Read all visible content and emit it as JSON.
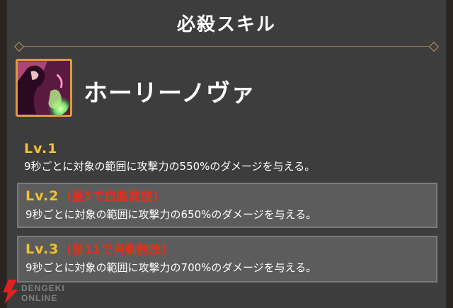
{
  "panel": {
    "title": "必殺スキル"
  },
  "skill": {
    "name": "ホーリーノヴァ",
    "icon": "holy-nova-skill-art"
  },
  "levels": [
    {
      "label": "Lv.1",
      "unlock": "",
      "description": "9秒ごとに対象の範囲に攻撃力の550%のダメージを与える。"
    },
    {
      "label": "Lv.2",
      "unlock": "(星5で自動開放)",
      "description": "9秒ごとに対象の範囲に攻撃力の650%のダメージを与える。"
    },
    {
      "label": "Lv.3",
      "unlock": "(星11で自動開放)",
      "description": "9秒ごとに対象の範囲に攻撃力の700%のダメージを与える。"
    }
  ],
  "watermark": {
    "text": "DENGEKI ONLINE"
  },
  "colors": {
    "level_label": "#f2c230",
    "unlock_text": "#e0301e",
    "icon_border": "#e09a3a",
    "panel_bg": "#3d3d3d"
  }
}
